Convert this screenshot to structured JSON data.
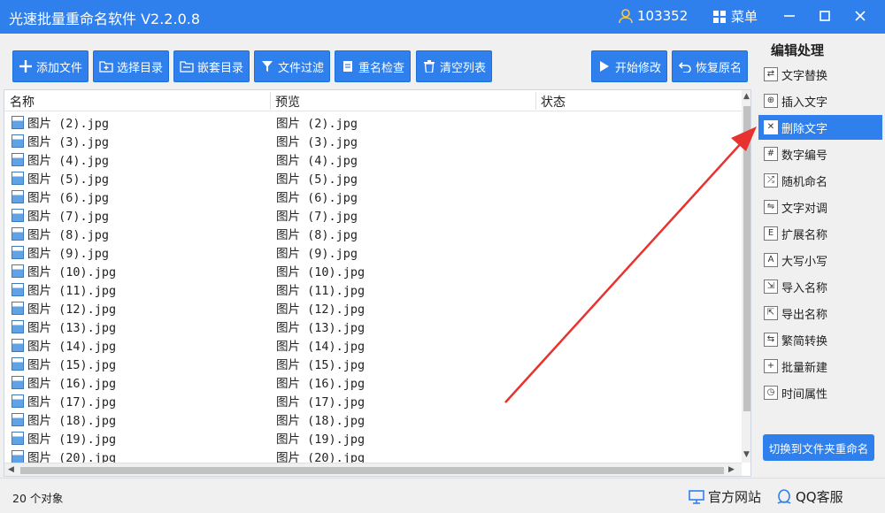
{
  "app": {
    "title": "光速批量重命名软件 V2.2.0.8",
    "user_id": "103352",
    "menu_label": "菜单"
  },
  "toolbar": {
    "add_file": "添加文件",
    "select_dir": "选择目录",
    "nested_dir": "嵌套目录",
    "filter": "文件过滤",
    "rename_check": "重名检查",
    "clear_list": "清空列表",
    "start": "开始修改",
    "restore": "恢复原名"
  },
  "list": {
    "columns": [
      "名称",
      "预览",
      "状态"
    ],
    "rows": [
      {
        "name": "图片 (2).jpg",
        "preview": "图片 (2).jpg"
      },
      {
        "name": "图片 (3).jpg",
        "preview": "图片 (3).jpg"
      },
      {
        "name": "图片 (4).jpg",
        "preview": "图片 (4).jpg"
      },
      {
        "name": "图片 (5).jpg",
        "preview": "图片 (5).jpg"
      },
      {
        "name": "图片 (6).jpg",
        "preview": "图片 (6).jpg"
      },
      {
        "name": "图片 (7).jpg",
        "preview": "图片 (7).jpg"
      },
      {
        "name": "图片 (8).jpg",
        "preview": "图片 (8).jpg"
      },
      {
        "name": "图片 (9).jpg",
        "preview": "图片 (9).jpg"
      },
      {
        "name": "图片 (10).jpg",
        "preview": "图片 (10).jpg"
      },
      {
        "name": "图片 (11).jpg",
        "preview": "图片 (11).jpg"
      },
      {
        "name": "图片 (12).jpg",
        "preview": "图片 (12).jpg"
      },
      {
        "name": "图片 (13).jpg",
        "preview": "图片 (13).jpg"
      },
      {
        "name": "图片 (14).jpg",
        "preview": "图片 (14).jpg"
      },
      {
        "name": "图片 (15).jpg",
        "preview": "图片 (15).jpg"
      },
      {
        "name": "图片 (16).jpg",
        "preview": "图片 (16).jpg"
      },
      {
        "name": "图片 (17).jpg",
        "preview": "图片 (17).jpg"
      },
      {
        "name": "图片 (18).jpg",
        "preview": "图片 (18).jpg"
      },
      {
        "name": "图片 (19).jpg",
        "preview": "图片 (19).jpg"
      },
      {
        "name": "图片 (20).jpg",
        "preview": "图片 (20).jpg"
      }
    ]
  },
  "sidebar": {
    "title": "编辑处理",
    "items": [
      {
        "label": "文字替换",
        "icon": "replace-icon"
      },
      {
        "label": "插入文字",
        "icon": "insert-text-icon"
      },
      {
        "label": "删除文字",
        "icon": "delete-text-icon",
        "active": true
      },
      {
        "label": "数字编号",
        "icon": "numbering-icon"
      },
      {
        "label": "随机命名",
        "icon": "shuffle-icon"
      },
      {
        "label": "文字对调",
        "icon": "swap-icon"
      },
      {
        "label": "扩展名称",
        "icon": "extension-icon"
      },
      {
        "label": "大写小写",
        "icon": "case-icon"
      },
      {
        "label": "导入名称",
        "icon": "import-icon"
      },
      {
        "label": "导出名称",
        "icon": "export-icon"
      },
      {
        "label": "繁简转换",
        "icon": "convert-icon"
      },
      {
        "label": "批量新建",
        "icon": "new-file-icon"
      },
      {
        "label": "时间属性",
        "icon": "clock-icon"
      }
    ],
    "switch_button": "切换到文件夹重命名"
  },
  "status": {
    "count": "20 个对象",
    "website": "官方网站",
    "qq": "QQ客服"
  },
  "colors": {
    "accent": "#2f80ec",
    "arrow": "#e8322f"
  }
}
